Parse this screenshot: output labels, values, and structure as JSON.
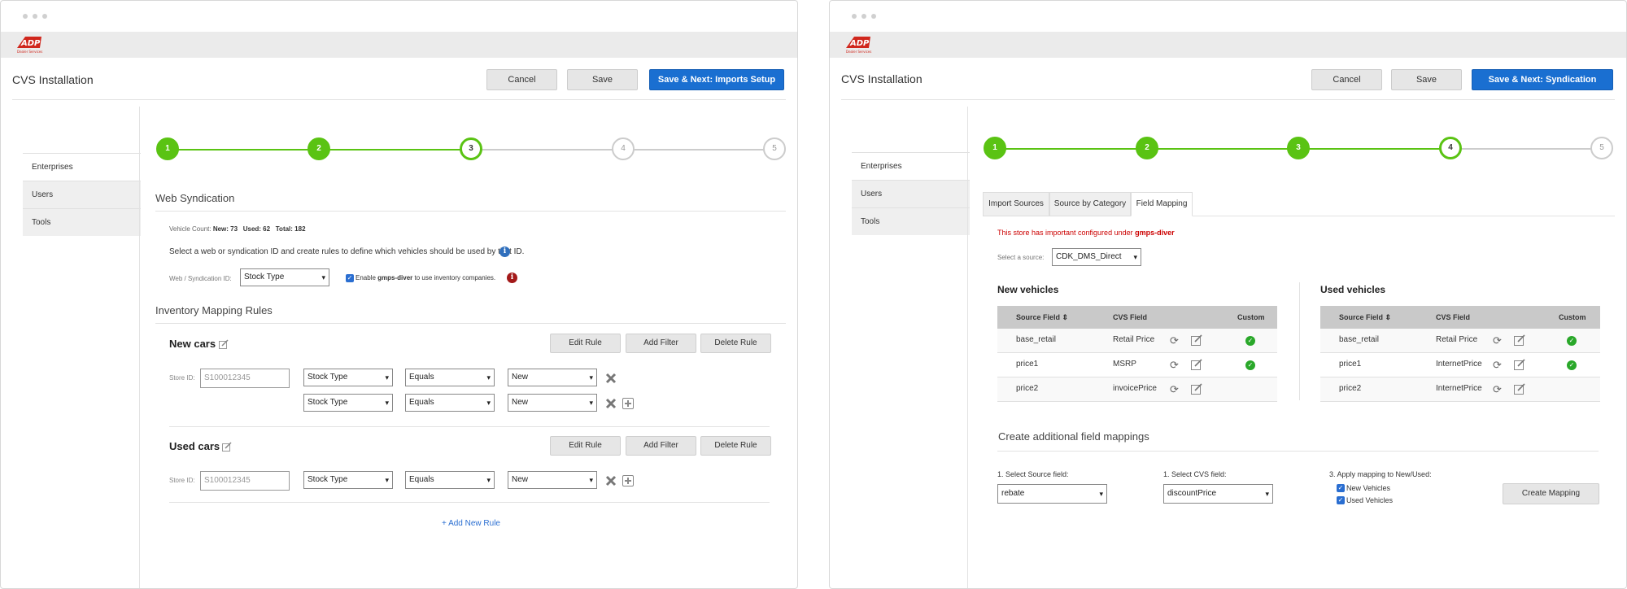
{
  "left": {
    "app_title": "CVS Installation",
    "buttons": {
      "cancel": "Cancel",
      "save": "Save",
      "next": "Save & Next: Imports Setup"
    },
    "sidebar": [
      {
        "label": "Enterprises"
      },
      {
        "label": "Users"
      },
      {
        "label": "Tools"
      }
    ],
    "steps": [
      "1",
      "2",
      "3",
      "4",
      "5"
    ],
    "section_title": "Web Syndication",
    "counts": {
      "prefix": "Vehicle Count:",
      "new": "New: 73",
      "used": "Used: 62",
      "total": "Total: 182"
    },
    "instruction": "Select a web or syndication ID and create rules to define which vehicles should be used by that ID.",
    "syndication_label": "Web / Syndication ID:",
    "syndication_value": "Stock Type",
    "enable_prefix": "Enable",
    "enable_bold": "gmps-diver",
    "enable_suffix": "to use inventory companies.",
    "mapping_title": "Inventory Mapping Rules",
    "new_cars": {
      "title": "New cars",
      "store_label": "Store ID:",
      "store_placeholder": "S100012345",
      "rows": [
        {
          "field": "Stock Type",
          "op": "Equals",
          "value": "New"
        },
        {
          "field": "Stock Type",
          "op": "Equals",
          "value": "New"
        }
      ]
    },
    "used_cars": {
      "title": "Used cars",
      "store_label": "Store ID:",
      "store_placeholder": "S100012345",
      "rows": [
        {
          "field": "Stock Type",
          "op": "Equals",
          "value": "New"
        }
      ]
    },
    "rule_buttons": {
      "edit": "Edit Rule",
      "add_filter": "Add Filter",
      "delete": "Delete Rule"
    },
    "add_rule": "+ Add New Rule"
  },
  "right": {
    "app_title": "CVS Installation",
    "buttons": {
      "cancel": "Cancel",
      "save": "Save",
      "next": "Save & Next: Syndication"
    },
    "sidebar": [
      {
        "label": "Enterprises"
      },
      {
        "label": "Users"
      },
      {
        "label": "Tools"
      }
    ],
    "steps": [
      "1",
      "2",
      "3",
      "4",
      "5"
    ],
    "tabs": [
      "Import Sources",
      "Source by Category",
      "Field Mapping"
    ],
    "warning_prefix": "This store has important configured under",
    "warning_bold": "gmps-diver",
    "source_label": "Select a source:",
    "source_value": "CDK_DMS_Direct",
    "new_title": "New vehicles",
    "used_title": "Used vehicles",
    "headers": {
      "source": "Source Field",
      "cvs": "CVS Field",
      "custom": "Custom"
    },
    "new_rows": [
      {
        "source": "base_retail",
        "cvs": "Retail Price",
        "custom": true
      },
      {
        "source": "price1",
        "cvs": "MSRP",
        "custom": true
      },
      {
        "source": "price2",
        "cvs": "invoicePrice",
        "custom": false
      }
    ],
    "used_rows": [
      {
        "source": "base_retail",
        "cvs": "Retail Price",
        "custom": true
      },
      {
        "source": "price1",
        "cvs": "InternetPrice",
        "custom": true
      },
      {
        "source": "price2",
        "cvs": "InternetPrice",
        "custom": false
      }
    ],
    "additional_title": "Create additional field mappings",
    "select_source_label": "1. Select Source field:",
    "select_source_value": "rebate",
    "select_cvs_label": "1. Select CVS field:",
    "select_cvs_value": "discountPrice",
    "apply_label": "3. Apply mapping to New/Used:",
    "apply_new": "New Vehicles",
    "apply_used": "Used Vehicles",
    "create_button": "Create Mapping"
  },
  "colors": {
    "green": "#5ac313",
    "blue": "#1a6fd1",
    "red": "#cc0000"
  }
}
